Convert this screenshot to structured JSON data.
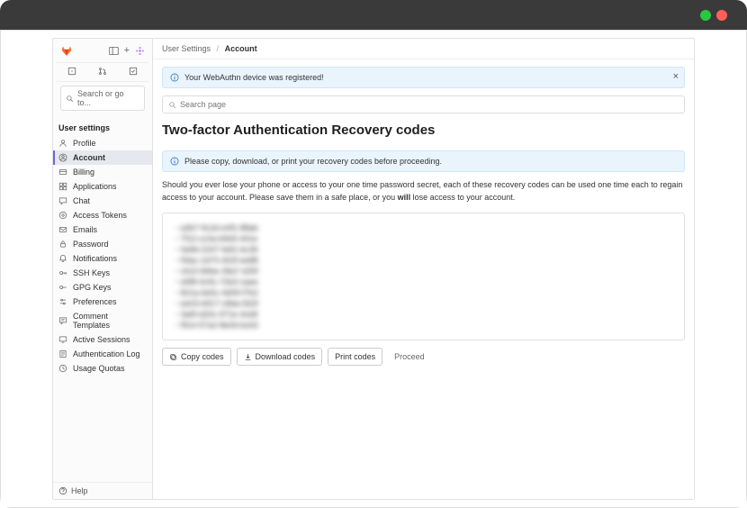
{
  "breadcrumb": {
    "parent": "User Settings",
    "current": "Account"
  },
  "sidebar": {
    "search_go": "Search or go to...",
    "section_title": "User settings",
    "items": [
      {
        "label": "Profile"
      },
      {
        "label": "Account"
      },
      {
        "label": "Billing"
      },
      {
        "label": "Applications"
      },
      {
        "label": "Chat"
      },
      {
        "label": "Access Tokens"
      },
      {
        "label": "Emails"
      },
      {
        "label": "Password"
      },
      {
        "label": "Notifications"
      },
      {
        "label": "SSH Keys"
      },
      {
        "label": "GPG Keys"
      },
      {
        "label": "Preferences"
      },
      {
        "label": "Comment Templates"
      },
      {
        "label": "Active Sessions"
      },
      {
        "label": "Authentication Log"
      },
      {
        "label": "Usage Quotas"
      }
    ],
    "help": "Help"
  },
  "alerts": {
    "registered": "Your WebAuthn device was registered!",
    "copy_notice": "Please copy, download, or print your recovery codes before proceeding."
  },
  "search": {
    "placeholder": "Search page"
  },
  "page": {
    "title": "Two-factor Authentication Recovery codes",
    "desc_pre": "Should you ever lose your phone or access to your one time password secret, each of these recovery codes can be used one time each to regain access to your account. Please save them in a safe place, or you ",
    "desc_bold": "will",
    "desc_post": " lose access to your account."
  },
  "codes": [
    "a3b7-9c2d-e4f1-88ab",
    "7f12-cc0a-b9d3-441e",
    "0e8d-2247-fa91-bc36",
    "59ac-1d73-402f-ee88",
    "c610-84be-39a7-d25f",
    "d4f8-0c91-72b3-1aee",
    "821a-6e5c-4d09-f7b2",
    "ee03-b917-c8da-562f",
    "3a5f-d20c-971e-4cb8",
    "f914-57a2-8e0d-bc63"
  ],
  "buttons": {
    "copy": "Copy codes",
    "download": "Download codes",
    "print": "Print codes",
    "proceed": "Proceed"
  }
}
